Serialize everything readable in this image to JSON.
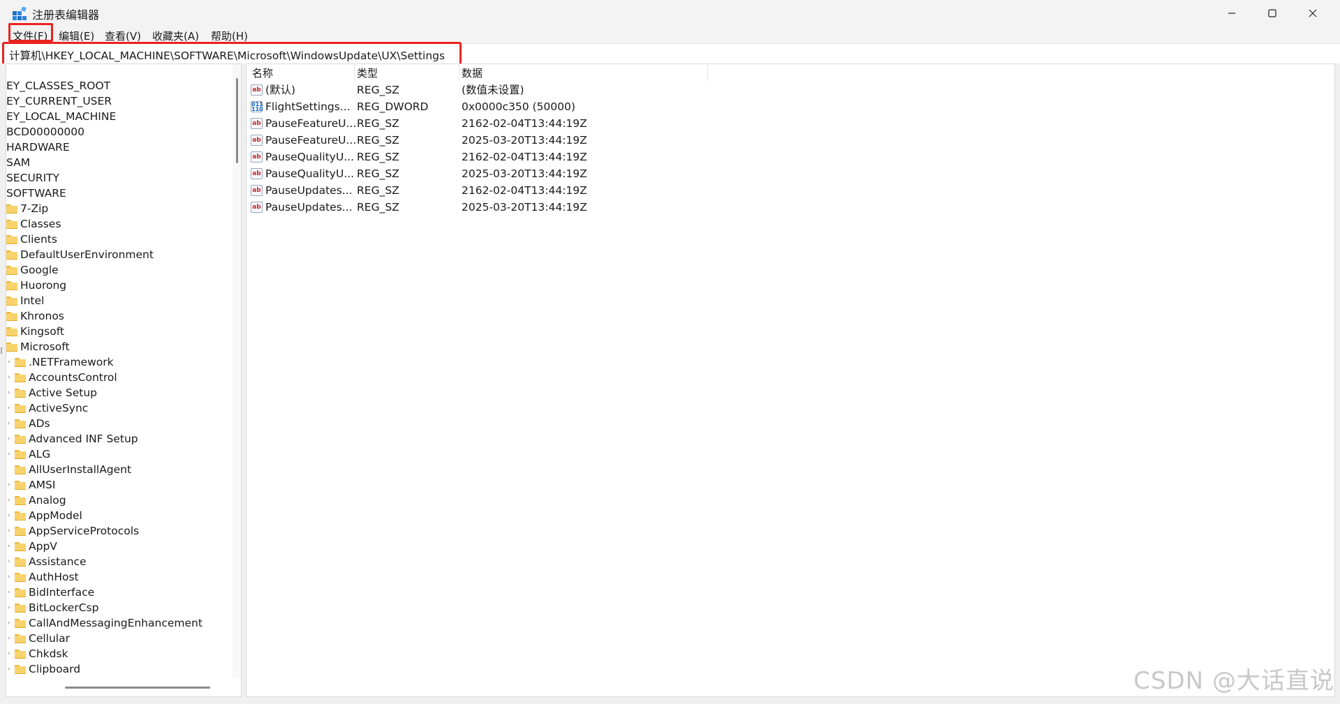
{
  "window": {
    "title": "注册表编辑器",
    "controls": [
      "minimize-icon",
      "maximize-icon",
      "close-icon"
    ]
  },
  "menu": {
    "items": [
      {
        "label": "文件(F)"
      },
      {
        "label": "编辑(E)"
      },
      {
        "label": "查看(V)"
      },
      {
        "label": "收藏夹(A)"
      },
      {
        "label": "帮助(H)"
      }
    ]
  },
  "address": {
    "path": "计算机\\HKEY_LOCAL_MACHINE\\SOFTWARE\\Microsoft\\WindowsUpdate\\UX\\Settings"
  },
  "tree": {
    "items": [
      {
        "label": "EY_CLASSES_ROOT"
      },
      {
        "label": "EY_CURRENT_USER"
      },
      {
        "label": "EY_LOCAL_MACHINE"
      },
      {
        "label": "BCD00000000"
      },
      {
        "label": "HARDWARE"
      },
      {
        "label": "SAM"
      },
      {
        "label": "SECURITY"
      },
      {
        "label": "SOFTWARE"
      },
      {
        "label": "7-Zip"
      },
      {
        "label": "Classes"
      },
      {
        "label": "Clients"
      },
      {
        "label": "DefaultUserEnvironment"
      },
      {
        "label": "Google"
      },
      {
        "label": "Huorong"
      },
      {
        "label": "Intel"
      },
      {
        "label": "Khronos"
      },
      {
        "label": "Kingsoft"
      },
      {
        "label": "Microsoft"
      },
      {
        "label": ".NETFramework"
      },
      {
        "label": "AccountsControl"
      },
      {
        "label": "Active Setup"
      },
      {
        "label": "ActiveSync"
      },
      {
        "label": "ADs"
      },
      {
        "label": "Advanced INF Setup"
      },
      {
        "label": "ALG"
      },
      {
        "label": "AllUserInstallAgent"
      },
      {
        "label": "AMSI"
      },
      {
        "label": "Analog"
      },
      {
        "label": "AppModel"
      },
      {
        "label": "AppServiceProtocols"
      },
      {
        "label": "AppV"
      },
      {
        "label": "Assistance"
      },
      {
        "label": "AuthHost"
      },
      {
        "label": "BidInterface"
      },
      {
        "label": "BitLockerCsp"
      },
      {
        "label": "CallAndMessagingEnhancement"
      },
      {
        "label": "Cellular"
      },
      {
        "label": "Chkdsk"
      },
      {
        "label": "Clipboard"
      }
    ]
  },
  "list": {
    "columns": [
      "名称",
      "类型",
      "数据"
    ],
    "rows": [
      {
        "icon": "string-value-icon",
        "name": "(默认)",
        "type": "REG_SZ",
        "data": "(数值未设置)"
      },
      {
        "icon": "dword-value-icon",
        "name": "FlightSettings...",
        "type": "REG_DWORD",
        "data": "0x0000c350 (50000)"
      },
      {
        "icon": "string-value-icon",
        "name": "PauseFeatureU...",
        "type": "REG_SZ",
        "data": "2162-02-04T13:44:19Z"
      },
      {
        "icon": "string-value-icon",
        "name": "PauseFeatureU...",
        "type": "REG_SZ",
        "data": "2025-03-20T13:44:19Z"
      },
      {
        "icon": "string-value-icon",
        "name": "PauseQualityU...",
        "type": "REG_SZ",
        "data": "2162-02-04T13:44:19Z"
      },
      {
        "icon": "string-value-icon",
        "name": "PauseQualityU...",
        "type": "REG_SZ",
        "data": "2025-03-20T13:44:19Z"
      },
      {
        "icon": "string-value-icon",
        "name": "PauseUpdates...",
        "type": "REG_SZ",
        "data": "2162-02-04T13:44:19Z"
      },
      {
        "icon": "string-value-icon",
        "name": "PauseUpdates...",
        "type": "REG_SZ",
        "data": "2025-03-20T13:44:19Z"
      }
    ]
  },
  "watermark": "CSDN @大话直说",
  "colors": {
    "highlight": "#e8231f",
    "folder": "#f8d26a",
    "chrome": "#f3f3f3"
  }
}
